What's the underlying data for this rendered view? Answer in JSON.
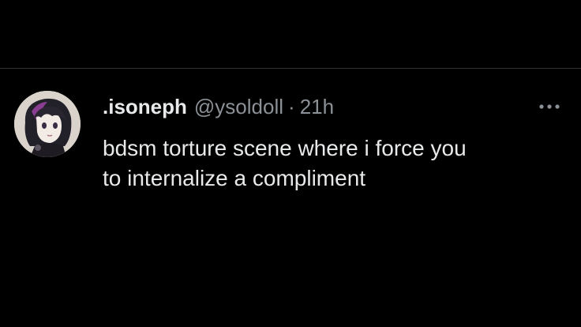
{
  "tweet": {
    "display_name": ".isoneph",
    "handle": "@ysoldoll",
    "separator": "·",
    "time": "21h",
    "text_lines": [
      "bdsm torture scene where i force you",
      "to internalize a compliment"
    ]
  },
  "icons": {
    "more": "more-horizontal-icon",
    "avatar": "profile-avatar"
  },
  "colors": {
    "background": "#000000",
    "primary_text": "#e7e9ea",
    "secondary_text": "#8b9196",
    "divider": "#2f3336"
  }
}
